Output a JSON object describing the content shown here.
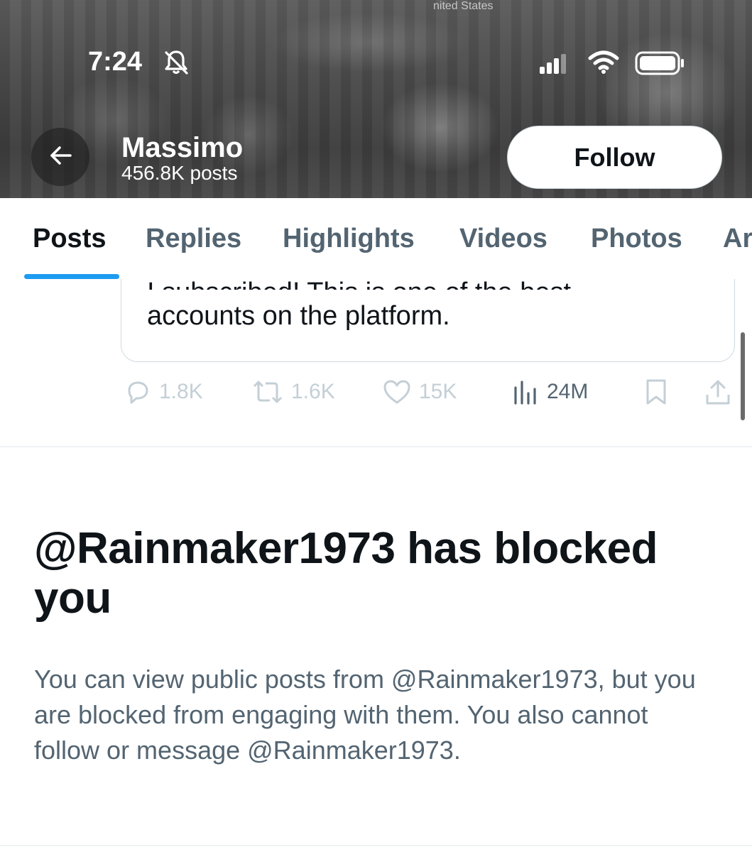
{
  "status_bar": {
    "time": "7:24",
    "icons": [
      "bell-slash-icon",
      "cellular-signal-icon",
      "wifi-icon",
      "battery-icon"
    ]
  },
  "banner": {
    "sign_text": "nited States"
  },
  "header": {
    "profile_name": "Massimo",
    "post_count": "456.8K posts",
    "follow_label": "Follow",
    "back_icon": "arrow-left-icon"
  },
  "tabs": [
    {
      "label": "Posts",
      "active": true
    },
    {
      "label": "Replies",
      "active": false
    },
    {
      "label": "Highlights",
      "active": false
    },
    {
      "label": "Videos",
      "active": false
    },
    {
      "label": "Photos",
      "active": false
    },
    {
      "label": "Ar",
      "active": false
    }
  ],
  "quote": {
    "cut_line": "I subscribed! This is one of the best",
    "last_line": "accounts on the platform."
  },
  "actions": {
    "replies": "1.8K",
    "reposts": "1.6K",
    "likes": "15K",
    "views": "24M"
  },
  "blocked": {
    "title": "@Rainmaker1973 has blocked you",
    "body": "You can view public posts from @Rainmaker1973, but you are blocked from engaging with them. You also cannot follow or message @Rainmaker1973."
  },
  "colors": {
    "accent": "#1d9bf0",
    "text_primary": "#0f1419",
    "text_secondary": "#536471",
    "muted_action": "#c4cfd6"
  }
}
